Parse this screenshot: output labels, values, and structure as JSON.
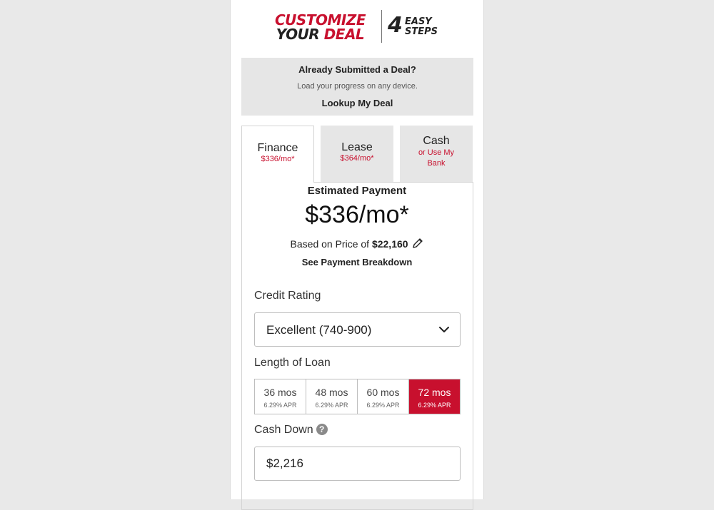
{
  "header": {
    "logo_line1": "CUSTOMIZE",
    "logo_line2_a": "YOUR",
    "logo_line2_b": "DEAL",
    "logo_number": "4",
    "logo_steps_1": "EASY",
    "logo_steps_2": "STEPS"
  },
  "lookup": {
    "title": "Already Submitted a Deal?",
    "subtitle": "Load your progress on any device.",
    "link": "Lookup My Deal"
  },
  "tabs": [
    {
      "title": "Finance",
      "sub": "$336/mo*",
      "active": true
    },
    {
      "title": "Lease",
      "sub": "$364/mo*",
      "active": false
    },
    {
      "title": "Cash",
      "sub": "or Use My Bank",
      "active": false
    }
  ],
  "payment": {
    "label": "Estimated Payment",
    "value": "$336/mo*",
    "based_prefix": "Based on Price of",
    "price": "$22,160",
    "breakdown_link": "See Payment Breakdown"
  },
  "credit": {
    "label": "Credit Rating",
    "selected": "Excellent (740-900)"
  },
  "loan": {
    "label": "Length of Loan",
    "options": [
      {
        "term": "36 mos",
        "apr": "6.29% APR",
        "selected": false
      },
      {
        "term": "48 mos",
        "apr": "6.29% APR",
        "selected": false
      },
      {
        "term": "60 mos",
        "apr": "6.29% APR",
        "selected": false
      },
      {
        "term": "72 mos",
        "apr": "6.29% APR",
        "selected": true
      }
    ]
  },
  "cash_down": {
    "label": "Cash Down",
    "help_symbol": "?",
    "value": "$2,216"
  },
  "colors": {
    "accent": "#c8102e",
    "panel_gray": "#e6e6e6",
    "background": "#e9e9e9"
  },
  "icons": [
    "pencil-icon",
    "chevron-down-icon",
    "help-icon"
  ]
}
